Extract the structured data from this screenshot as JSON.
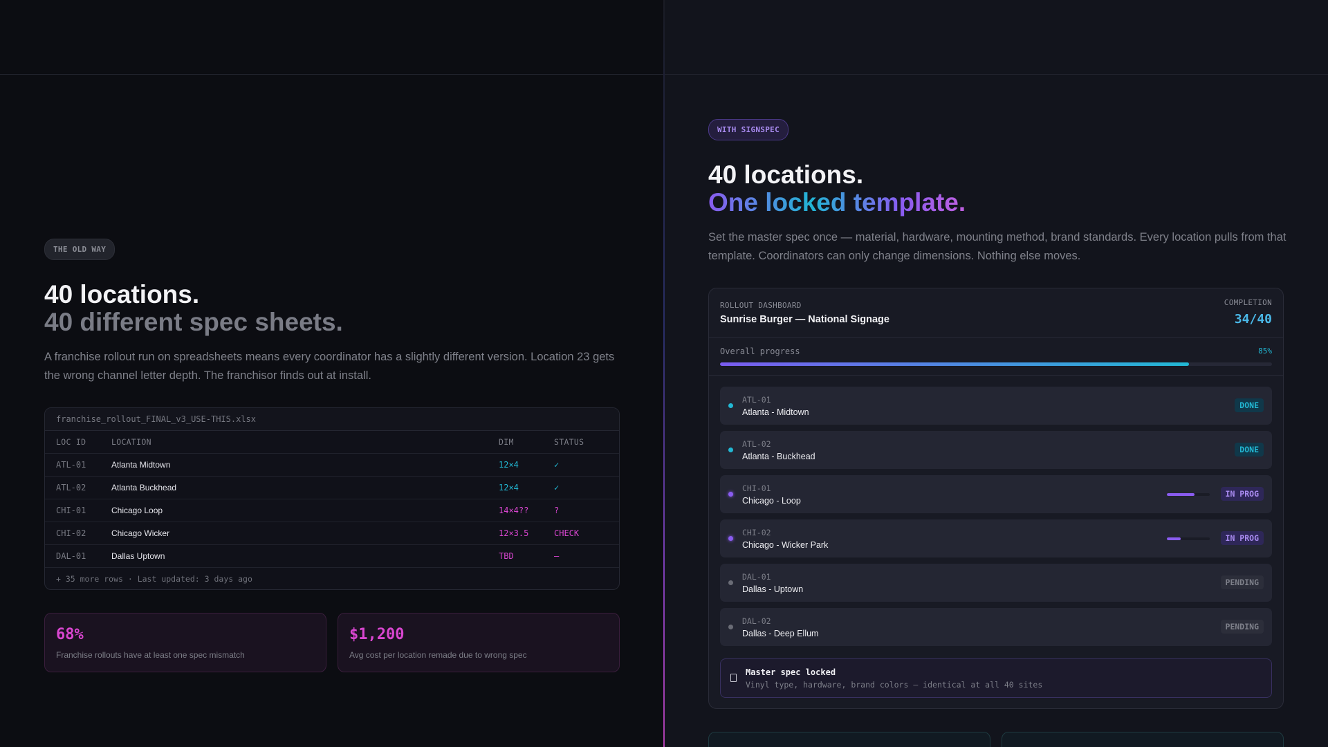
{
  "colors": {
    "accent_cyan": "#22b8d4",
    "accent_violet": "#8a5cf0",
    "accent_magenta": "#d946d0",
    "bg_left": "#0c0d12",
    "bg_right": "#12141c"
  },
  "left": {
    "badge": "THE OLD WAY",
    "heading_line1": "40 locations.",
    "heading_line2": "40 different spec sheets.",
    "paragraph": "A franchise rollout run on spreadsheets means every coordinator has a slightly different version. Location 23 gets the wrong channel letter depth. The franchisor finds out at install.",
    "spreadsheet": {
      "filename": "franchise_rollout_FINAL_v3_USE-THIS.xlsx",
      "columns": [
        "LOC ID",
        "LOCATION",
        "DIM",
        "STATUS"
      ],
      "rows": [
        {
          "id": "ATL-01",
          "location": "Atlanta Midtown",
          "dim": "12×4",
          "status": "✓"
        },
        {
          "id": "ATL-02",
          "location": "Atlanta Buckhead",
          "dim": "12×4",
          "status": "✓"
        },
        {
          "id": "CHI-01",
          "location": "Chicago Loop",
          "dim": "14×4??",
          "status": "?"
        },
        {
          "id": "CHI-02",
          "location": "Chicago Wicker",
          "dim": "12×3.5",
          "status": "CHECK"
        },
        {
          "id": "DAL-01",
          "location": "Dallas Uptown",
          "dim": "TBD",
          "status": "—"
        }
      ],
      "footer": "+ 35 more rows · Last updated: 3 days ago"
    },
    "stats": [
      {
        "value": "68%",
        "label": "Franchise rollouts have at least one spec mismatch"
      },
      {
        "value": "$1,200",
        "label": "Avg cost per location remade due to wrong spec"
      }
    ]
  },
  "right": {
    "badge": "WITH SIGNSPEC",
    "heading_line1": "40 locations.",
    "heading_line2": "One locked template.",
    "paragraph": "Set the master spec once — material, hardware, mounting method, brand standards. Every location pulls from that template. Coordinators can only change dimensions. Nothing else moves.",
    "dashboard": {
      "kicker": "ROLLOUT DASHBOARD",
      "title": "Sunrise Burger — National Signage",
      "completion_label": "COMPLETION",
      "completion_value": "34/40",
      "progress_label": "Overall progress",
      "progress_text": "85%",
      "progress_fraction": 0.85,
      "locations": [
        {
          "id": "ATL-01",
          "name": "Atlanta - Midtown",
          "status": "DONE",
          "state": "done"
        },
        {
          "id": "ATL-02",
          "name": "Atlanta - Buckhead",
          "status": "DONE",
          "state": "done"
        },
        {
          "id": "CHI-01",
          "name": "Chicago - Loop",
          "status": "IN PROG",
          "state": "prog",
          "progress": 0.65
        },
        {
          "id": "CHI-02",
          "name": "Chicago - Wicker Park",
          "status": "IN PROG",
          "state": "prog",
          "progress": 0.32
        },
        {
          "id": "DAL-01",
          "name": "Dallas - Uptown",
          "status": "PENDING",
          "state": "pend"
        },
        {
          "id": "DAL-02",
          "name": "Dallas - Deep Ellum",
          "status": "PENDING",
          "state": "pend"
        }
      ],
      "lock_title": "Master spec locked",
      "lock_subtitle": "Vinyl type, hardware, brand colors — identical at all 40 sites"
    }
  }
}
